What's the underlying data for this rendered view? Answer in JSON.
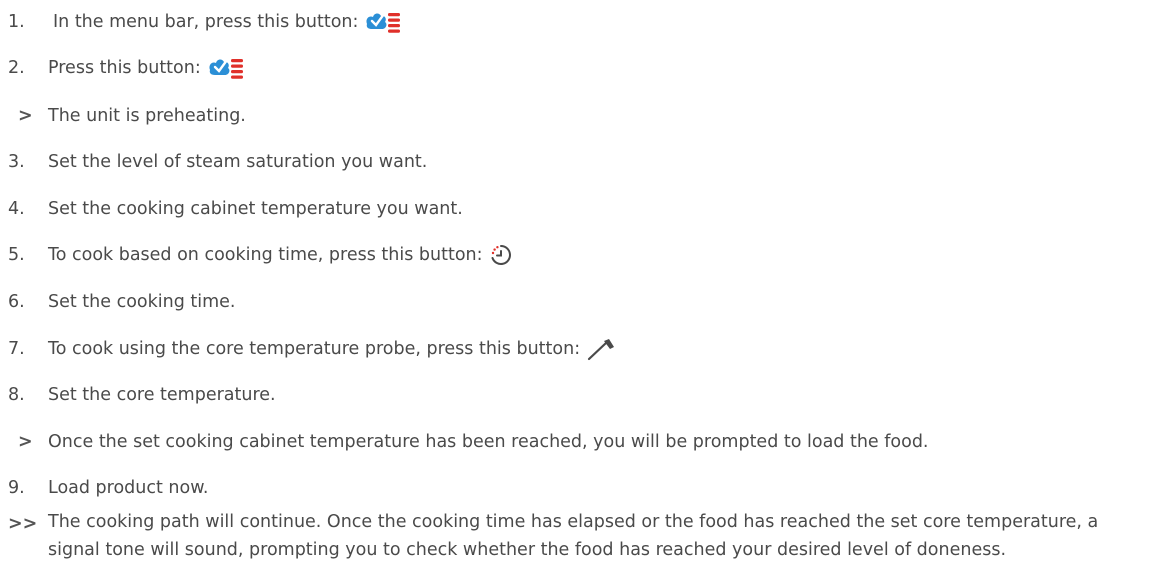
{
  "steps": [
    {
      "marker": "1.",
      "text": "In the menu bar, press this button:",
      "icon": "steam-combi-icon"
    },
    {
      "marker": "2.",
      "text": "Press this button:",
      "icon": "steam-combi-icon"
    },
    {
      "marker": ">",
      "text": "The unit is preheating."
    },
    {
      "marker": "3.",
      "text": "Set the level of steam saturation you want."
    },
    {
      "marker": "4.",
      "text": "Set the cooking cabinet temperature you want."
    },
    {
      "marker": "5.",
      "text": "To cook based on cooking time, press this button:",
      "icon": "timer-icon"
    },
    {
      "marker": "6.",
      "text": "Set the cooking time."
    },
    {
      "marker": "7.",
      "text": "To cook using the core temperature probe, press this button:",
      "icon": "core-probe-icon"
    },
    {
      "marker": "8.",
      "text": "Set the core temperature."
    },
    {
      "marker": ">",
      "text": "Once the set cooking cabinet temperature has been reached, you will be prompted to load the food."
    },
    {
      "marker": "9.",
      "text": "Load product now."
    },
    {
      "marker": ">>",
      "text": "The cooking path will continue. Once the cooking time has elapsed or the food has reached the set core temperature, a signal tone will sound, prompting you to check whether the food has reached your desired level of doneness."
    }
  ],
  "colors": {
    "text": "#4a4a4a",
    "steam_blue": "#2b8fd6",
    "heat_red": "#e0302a",
    "timer_red": "#e0302a"
  }
}
